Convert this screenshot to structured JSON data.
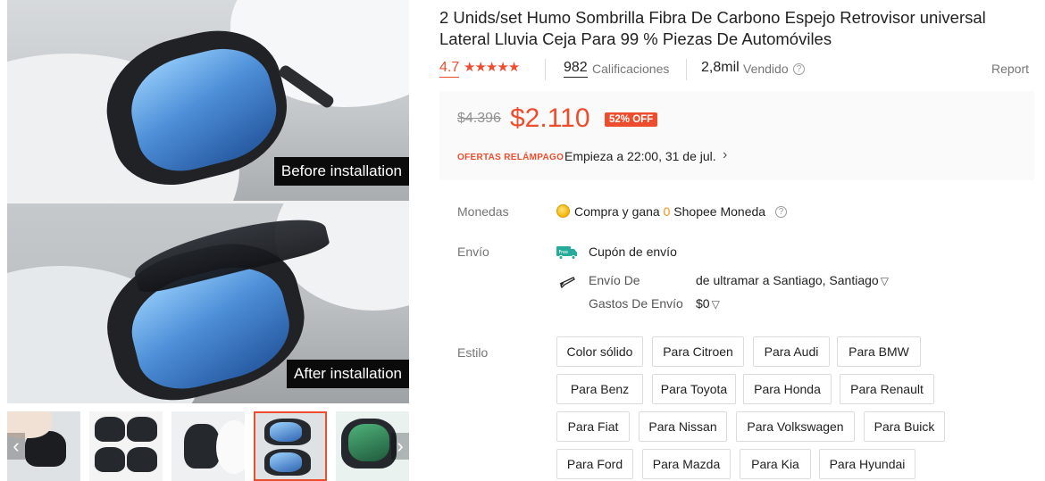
{
  "gallery": {
    "captions": {
      "before": "Before installation",
      "after": "After installation"
    },
    "thumb_prev_icon": "chevron-left-icon",
    "thumb_next_icon": "chevron-right-icon"
  },
  "product": {
    "title": "2 Unids/set Humo Sombrilla Fibra De Carbono Espejo Retrovisor universal Lateral Lluvia Ceja Para 99 % Piezas De Automóviles",
    "rating": "4.7",
    "stars": 4.7,
    "rating_count": "982",
    "rating_count_label": "Calificaciones",
    "sold": "2,8mil",
    "sold_label": "Vendido",
    "report_label": "Report"
  },
  "price": {
    "original": "$4.396",
    "current": "$2.110",
    "discount": "52% OFF",
    "flash_logo": "OFERTAS RELÁMPAGO",
    "flash_text": "Empieza a 22:00, 31 de jul."
  },
  "coins": {
    "label": "Monedas",
    "text_prefix": "Compra y gana",
    "amount": "0",
    "text_suffix": "Shopee Moneda"
  },
  "shipping": {
    "label": "Envío",
    "free_badge": "Free",
    "coupon": "Cupón de envío",
    "from_label": "Envío De",
    "from_value": "de ultramar a Santiago, Santiago",
    "cost_label": "Gastos De Envío",
    "cost_value": "$0"
  },
  "style": {
    "label": "Estilo",
    "options": [
      "Color sólido",
      "Para Citroen",
      "Para Audi",
      "Para BMW",
      "Para Benz",
      "Para Toyota",
      "Para Honda",
      "Para Renault",
      "Para Fiat",
      "Para Nissan",
      "Para Volkswagen",
      "Para Buick",
      "Para Ford",
      "Para Mazda",
      "Para Kia",
      "Para Hyundai"
    ]
  },
  "colors": {
    "accent": "#ee4d2d",
    "coin": "#f69113",
    "muted": "#757575"
  }
}
